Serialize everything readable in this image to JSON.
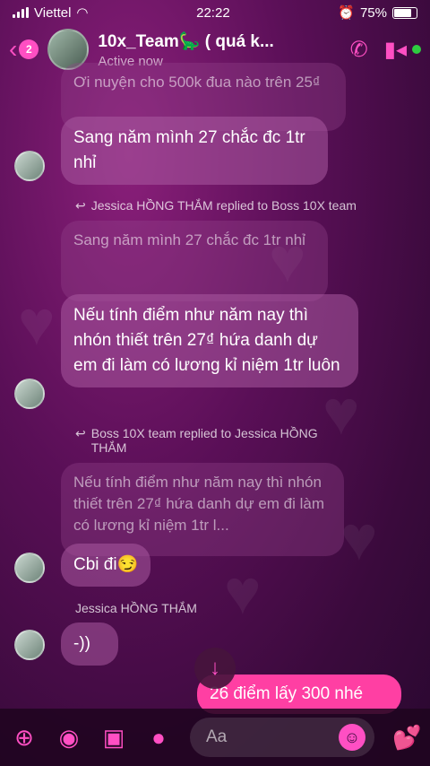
{
  "status": {
    "carrier": "Viettel",
    "time": "22:22",
    "battery": "75%"
  },
  "header": {
    "unread_count": "2",
    "title": "10x_Team🦕 ( quá k...",
    "subtitle": "Active now"
  },
  "messages": {
    "top_partial": "Ơi nuyện cho 500k đua nào trên 25₫",
    "m1": "Sang năm mình 27 chắc đc 1tr nhỉ",
    "reply_note_1": "Jessica HỒNG THẮM replied to Boss 10X team",
    "quote_1": "Sang năm mình 27 chắc đc 1tr nhỉ",
    "m2": "Nếu tính điểm như năm nay thì nhón thiết trên 27₫ hứa danh dự em đi làm có lương kỉ niệm 1tr luôn",
    "reply_note_2": "Boss 10X team replied to Jessica HỒNG THẮM",
    "quote_2": "Nếu tính điểm như năm nay thì nhón thiết trên 27₫ hứa danh dự em đi làm có lương kỉ niệm 1tr l...",
    "m3": "Cbi đi😏",
    "sender_name": "Jessica HỒNG THẮM",
    "m4": "-))",
    "m5_mine": "26 điểm lấy 300 nhé"
  },
  "composer": {
    "placeholder": "Aa"
  },
  "colors": {
    "accent": "#ff4fc3"
  }
}
